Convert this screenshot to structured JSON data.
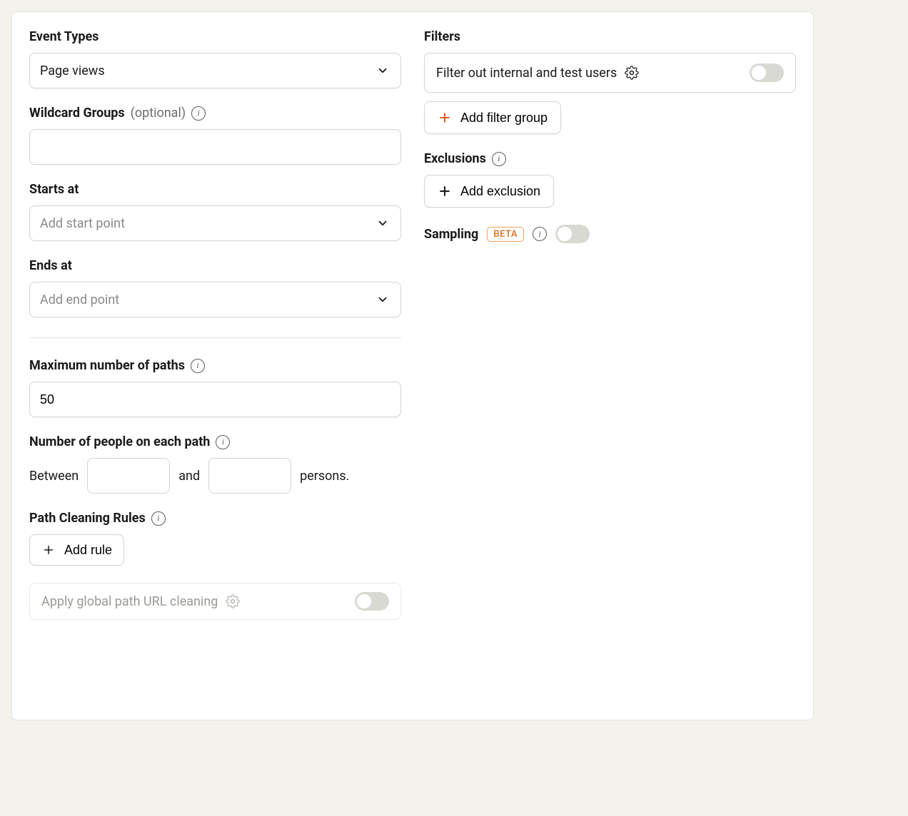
{
  "left": {
    "eventTypes": {
      "label": "Event Types",
      "value": "Page views"
    },
    "wildcardGroups": {
      "label": "Wildcard Groups",
      "optional": "(optional)",
      "value": ""
    },
    "startsAt": {
      "label": "Starts at",
      "placeholder": "Add start point"
    },
    "endsAt": {
      "label": "Ends at",
      "placeholder": "Add end point"
    },
    "maxPaths": {
      "label": "Maximum number of paths",
      "value": "50"
    },
    "peoplePerPath": {
      "label": "Number of people on each path",
      "between": "Between",
      "and": "and",
      "persons": "persons.",
      "min": "",
      "max": ""
    },
    "pathCleaning": {
      "label": "Path Cleaning Rules",
      "addRule": "Add rule",
      "globalCleaning": "Apply global path URL cleaning"
    }
  },
  "right": {
    "filters": {
      "label": "Filters",
      "filterOut": "Filter out internal and test users",
      "addGroup": "Add filter group"
    },
    "exclusions": {
      "label": "Exclusions",
      "addExclusion": "Add exclusion"
    },
    "sampling": {
      "label": "Sampling",
      "badge": "BETA"
    }
  }
}
